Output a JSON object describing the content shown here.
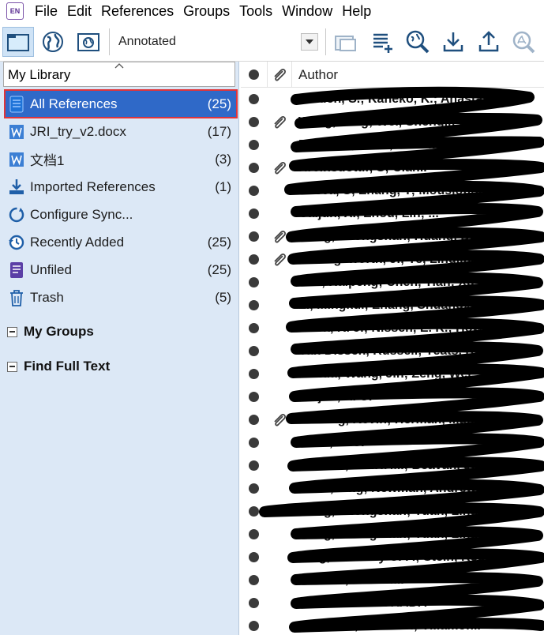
{
  "app_icon_text": "EN",
  "menu": [
    "File",
    "Edit",
    "References",
    "Groups",
    "Tools",
    "Window",
    "Help"
  ],
  "toolbar": {
    "style_value": "Annotated",
    "buttons": [
      "local-library-icon",
      "online-search-icon",
      "integrated-library-icon",
      "new-group-icon",
      "new-reference-icon",
      "online-search-magnifier-icon",
      "import-icon",
      "export-icon",
      "find-full-text-icon"
    ]
  },
  "left": {
    "library_label": "My Library",
    "items": [
      {
        "label": "All References",
        "count": "(25)",
        "icon": "all-references-icon"
      },
      {
        "label": "JRI_try_v2.docx",
        "count": "(17)",
        "icon": "word-doc-icon"
      },
      {
        "label": "文档1",
        "count": "(3)",
        "icon": "word-doc-icon"
      },
      {
        "label": "Imported References",
        "count": "(1)",
        "icon": "imported-icon"
      },
      {
        "label": "Configure Sync...",
        "count": "",
        "icon": "sync-icon"
      },
      {
        "label": "Recently Added",
        "count": "(25)",
        "icon": "recently-added-icon"
      },
      {
        "label": "Unfiled",
        "count": "(25)",
        "icon": "unfiled-icon"
      },
      {
        "label": "Trash",
        "count": "(5)",
        "icon": "trash-icon"
      }
    ],
    "sections": [
      "My Groups",
      "Find Full Text"
    ]
  },
  "right": {
    "author_header": "Author",
    "rows": [
      {
        "author": "Holden, S.; Kaneko, K.; Anastasi...",
        "attachment": false
      },
      {
        "author": "Wang, Teng; Wei, Shengji; Shi, X...",
        "attachment": true
      },
      {
        "author": "Barnhart, W. D.; Hammer, K. B.",
        "attachment": false
      },
      {
        "author": "Hreinsdottir, S; Clar...",
        "attachment": true
      },
      {
        "author": "Cesca, S; Zhang, Y; Mouslopoulou,...",
        "attachment": false
      },
      {
        "author": "Caijun, X.; Zhou, Lin; ...",
        "attachment": false
      },
      {
        "author": "Jiang, Zhongshan; Huang, Dingfa;...",
        "attachment": true
      },
      {
        "author": "Hollingsworth, J.; Ye, Lingling; ...",
        "attachment": true
      },
      {
        "author": "Luo, Haipeng; Chen, Tian; Xu, Caij...",
        "attachment": false
      },
      {
        "author": "Li, Mingkui; Zhang, Shuangxi; Zh...",
        "attachment": false
      },
      {
        "author": "Clark, K. J.; Nissen, E. K.; Howarth,...",
        "attachment": false
      },
      {
        "author": "Van Dissen, Russell; Yeats, Robert S.",
        "attachment": false
      },
      {
        "author": "Xuhua; Wang, Jin; Zeng, Wei...",
        "attachment": false
      },
      {
        "author": "Caijun, X. U.",
        "attachment": false
      },
      {
        "author": "Furlong, Kevin; Herman, Matthew",
        "attachment": true
      },
      {
        "author": "Stein, R. S.",
        "attachment": false
      },
      {
        "author": "Wallace, Laura M.; Beavan, John; B...",
        "attachment": false
      },
      {
        "author": "Chen, Ting; Newman, Andrew V.; F...",
        "attachment": false
      },
      {
        "author": "Jiang, Zhongshan; Yuan, Linguo; ...",
        "attachment": false
      },
      {
        "author": "Jiang, Zhongshan; Yuan, Linguo; ...",
        "attachment": false
      },
      {
        "author": "King, Geoffrey C. P.; Stein, Ross S.;...",
        "attachment": false
      },
      {
        "author": "Wallace, Laura M.",
        "attachment": false
      },
      {
        "author": "YOSHIMITSU OKADA",
        "attachment": false
      },
      {
        "author": "Litchfield, Nicola J.; Villamor...",
        "attachment": false
      }
    ]
  }
}
